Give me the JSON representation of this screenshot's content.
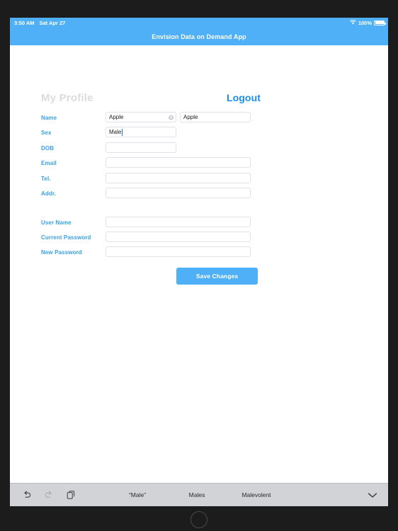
{
  "status_bar": {
    "time": "3:50 AM",
    "date": "Sat Apr 27",
    "wifi_icon": "wifi-icon",
    "battery_percent": "100%",
    "battery_icon": "battery-full-icon",
    "background_color": "#4fb0f7",
    "text_color": "#ffffff"
  },
  "app_bar": {
    "title": "Envision Data on Demand App",
    "background_color": "#4fb0f7"
  },
  "profile": {
    "page_title": "My Profile",
    "logout_label": "Logout",
    "accent_color": "#3aa0f0",
    "title_color": "#dcdcdc"
  },
  "form": {
    "rows": [
      {
        "label": "Name",
        "type": "pair",
        "value_a": "Apple",
        "value_b": "Apple",
        "clear_icon": "clear-circle-icon",
        "placeholder_a": "",
        "placeholder_b": ""
      },
      {
        "label": "Sex",
        "type": "short",
        "value": "Male",
        "focused": true,
        "placeholder": ""
      },
      {
        "label": "DOB",
        "type": "short",
        "value": "",
        "placeholder": ""
      },
      {
        "label": "Email",
        "type": "wide",
        "value": "",
        "placeholder": ""
      },
      {
        "label": "Tel.",
        "type": "wide",
        "value": "",
        "placeholder": ""
      },
      {
        "label": "Addr.",
        "type": "wide",
        "value": "",
        "placeholder": ""
      }
    ],
    "credentials": [
      {
        "label": "User Name",
        "type": "wide",
        "value": "",
        "placeholder": ""
      },
      {
        "label": "Current Password",
        "type": "wide",
        "value": "",
        "placeholder": ""
      },
      {
        "label": "New Password",
        "type": "wide",
        "value": "",
        "placeholder": ""
      }
    ],
    "save_label": "Save Changes",
    "save_color": "#4fb0f7"
  },
  "keyboard_toolbar": {
    "background_color": "#d2d3d7",
    "tools": [
      {
        "name": "undo-icon",
        "enabled": true
      },
      {
        "name": "redo-icon",
        "enabled": false
      },
      {
        "name": "paste-icon",
        "enabled": true
      }
    ],
    "suggestions": [
      "“Male”",
      "Males",
      "Malevolent"
    ],
    "dismiss_icon": "chevron-down-icon"
  },
  "home_button": {
    "name": "home-button"
  }
}
